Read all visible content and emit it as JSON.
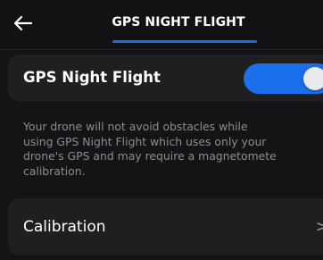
{
  "header": {
    "back_icon": "arrow-left-icon",
    "title": "GPS NIGHT FLIGHT"
  },
  "setting": {
    "label": "GPS Night Flight",
    "toggle_on": true,
    "description_lines": [
      "Your drone will not avoid obstacles while",
      "using GPS Night Flight which uses only your",
      "drone's GPS and may require a magnetomete",
      "calibration."
    ]
  },
  "calibration": {
    "label": "Calibration",
    "chevron": ">"
  },
  "colors": {
    "background": "#141416",
    "row_background": "#1f1f22",
    "accent": "#1a70ea",
    "text_secondary": "#8c8c94"
  }
}
